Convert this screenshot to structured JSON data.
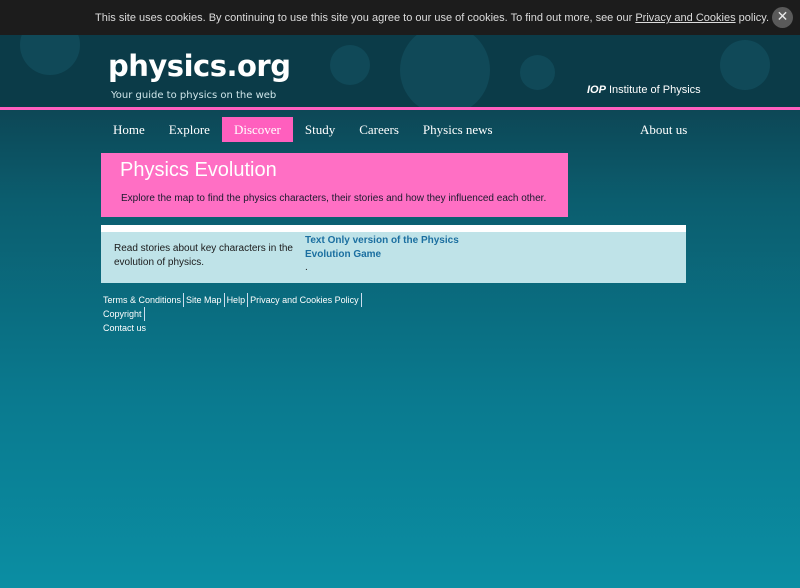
{
  "cookie_bar": {
    "text_before": "This site uses cookies. By continuing to use this site you agree to our use of cookies. To find out more, see our ",
    "link": "Privacy and Cookies",
    "text_after": " policy.",
    "close_glyph": "✕"
  },
  "header": {
    "logo": "physics.org",
    "tagline": "Your guide to physics on the web",
    "iop_mark": "IOP",
    "iop_name": "Institute of Physics"
  },
  "nav": {
    "items": [
      "Home",
      "Explore",
      "Discover",
      "Study",
      "Careers",
      "Physics news"
    ],
    "active": "Discover",
    "about": "About us"
  },
  "panel": {
    "title": "Physics Evolution",
    "description": "Explore the map to find the physics characters, their stories and how they influenced each other."
  },
  "content": {
    "text": "Read stories about key characters in the evolution of physics.",
    "link": "Text Only version of the Physics Evolution Game",
    "trailing": "."
  },
  "footer": {
    "links": [
      "Terms & Conditions",
      "Site Map",
      "Help",
      "Privacy and Cookies Policy",
      "Copyright"
    ],
    "contact": "Contact us"
  },
  "colors": {
    "accent_pink": "#ff5fbe",
    "panel_pink": "#ff6fc4",
    "content_bg": "#bfe3e8",
    "link_blue": "#1b6fa0"
  }
}
